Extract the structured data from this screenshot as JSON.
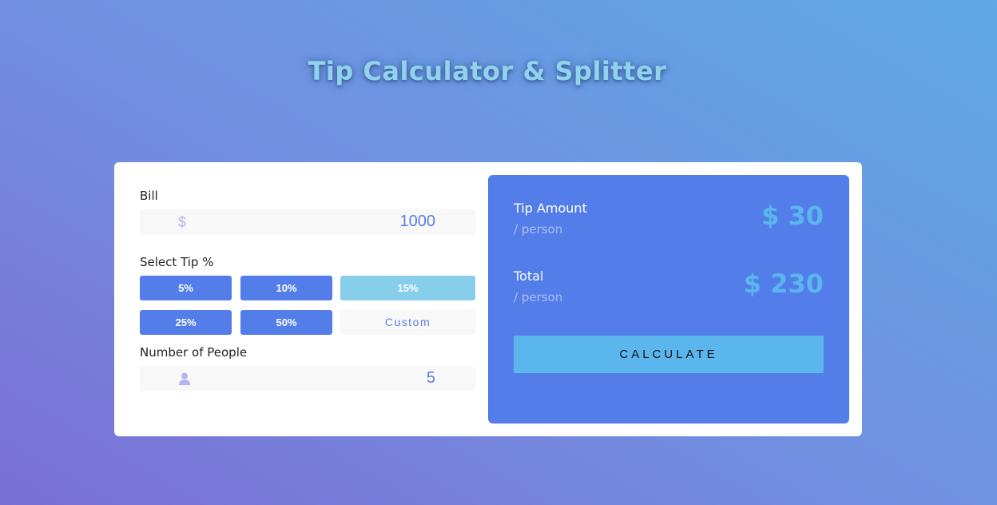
{
  "header": {
    "title": "Tip Calculator & Splitter"
  },
  "bill": {
    "label": "Bill",
    "currency_symbol": "$",
    "value": "1000"
  },
  "tip": {
    "label": "Select Tip %",
    "options": [
      {
        "label": "5%",
        "active": false
      },
      {
        "label": "10%",
        "active": false
      },
      {
        "label": "15%",
        "active": true
      },
      {
        "label": "25%",
        "active": false
      },
      {
        "label": "50%",
        "active": false
      }
    ],
    "custom_label": "Custom"
  },
  "people": {
    "label": "Number of People",
    "icon": "person-icon",
    "value": "5"
  },
  "results": {
    "tip_amount_label": "Tip Amount",
    "tip_amount_sub": "/ person",
    "tip_amount_value": "$ 30",
    "total_label": "Total",
    "total_sub": "/ person",
    "total_value": "$ 230",
    "calculate_label": "CALCULATE"
  },
  "colors": {
    "accent": "#537de9",
    "active_tip": "#87ceeb",
    "highlight": "#5ab6ec",
    "title": "#8fd3ec"
  }
}
